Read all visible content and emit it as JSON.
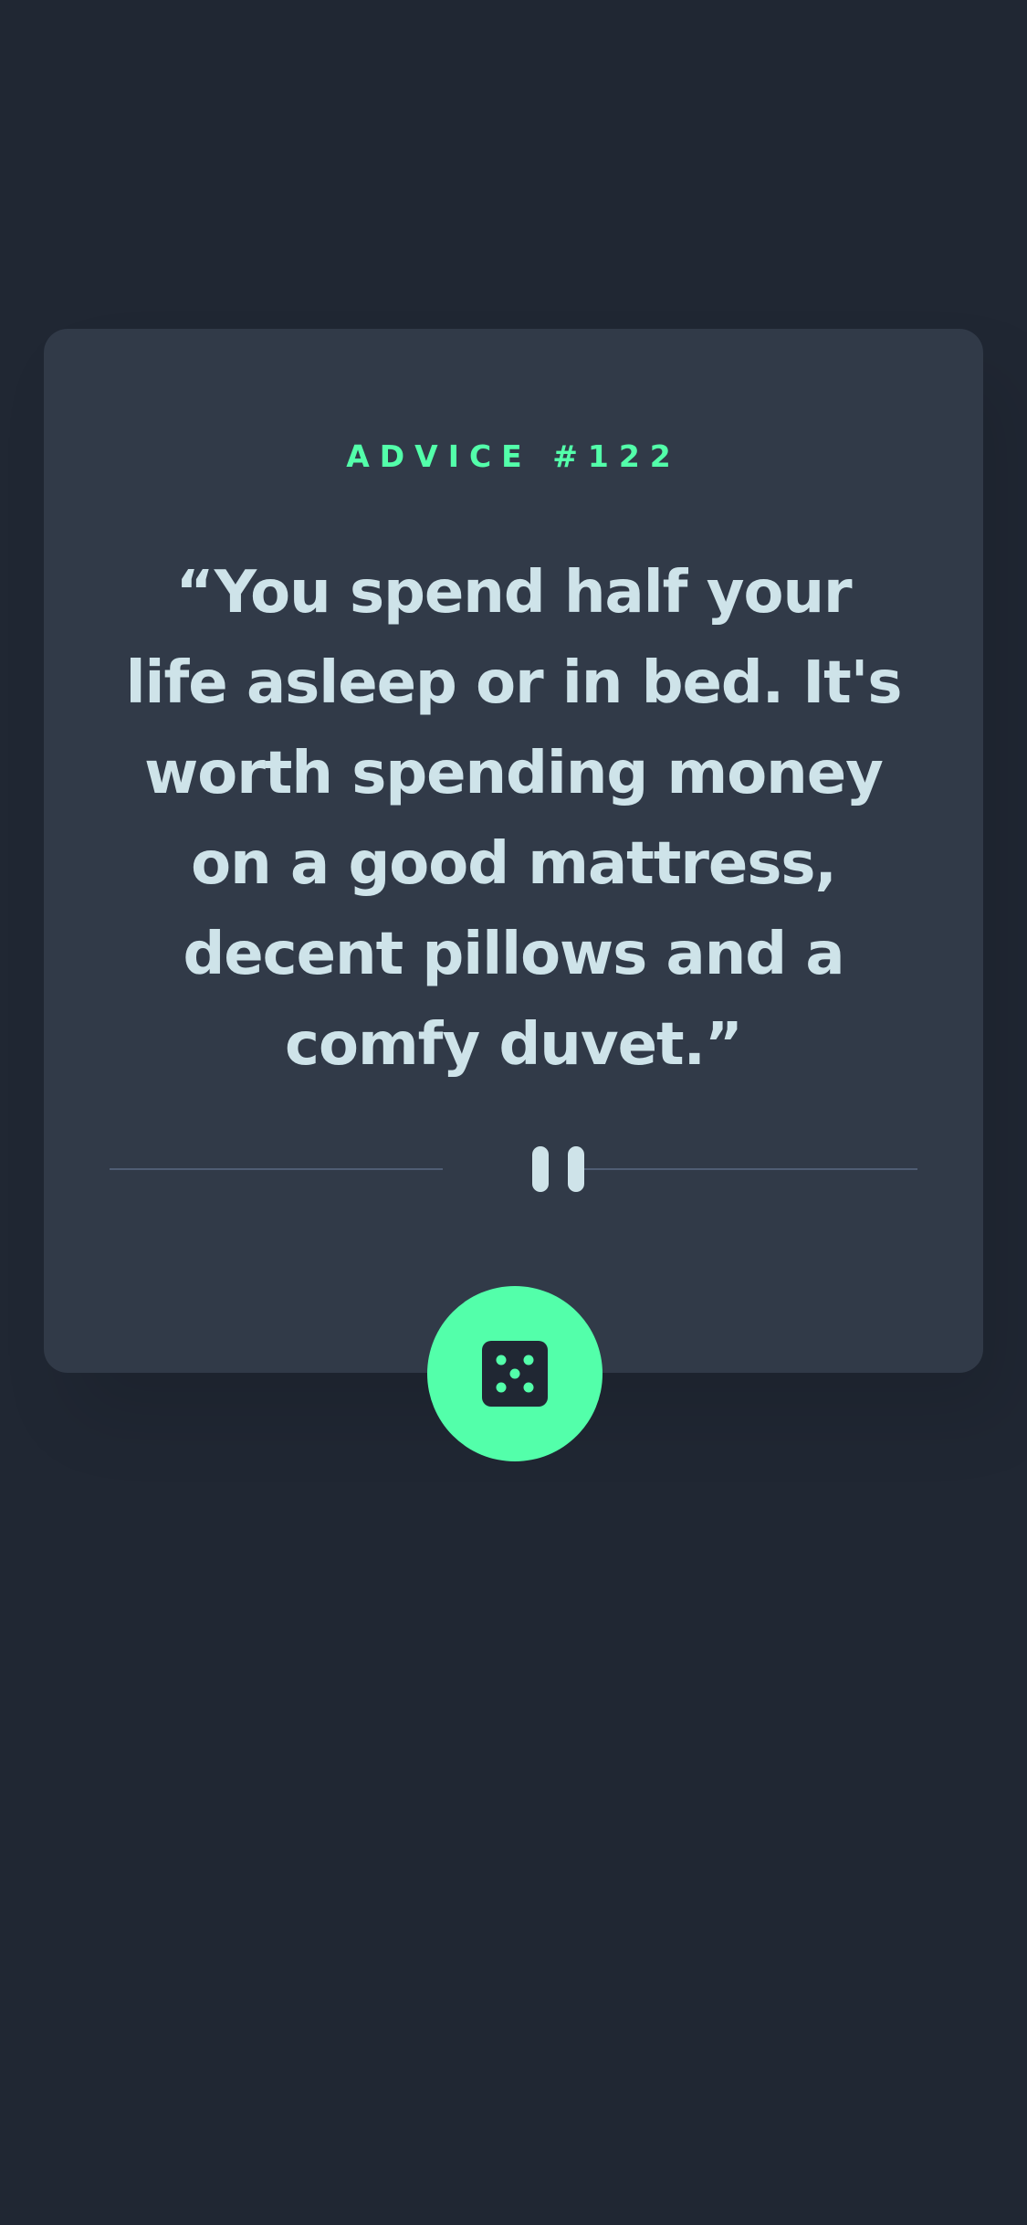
{
  "advice": {
    "label": "ADVICE #122",
    "quote": "“You spend half your life asleep or in bed. It's worth spending money on a good mattress, decent pillows and a comfy duvet.”"
  },
  "icons": {
    "divider": "pause-icon",
    "button": "dice-icon"
  },
  "colors": {
    "background": "#202733",
    "card": "#313A48",
    "accent": "#53FFAA",
    "text": "#CEE3E9",
    "divider": "#4F5D74"
  }
}
